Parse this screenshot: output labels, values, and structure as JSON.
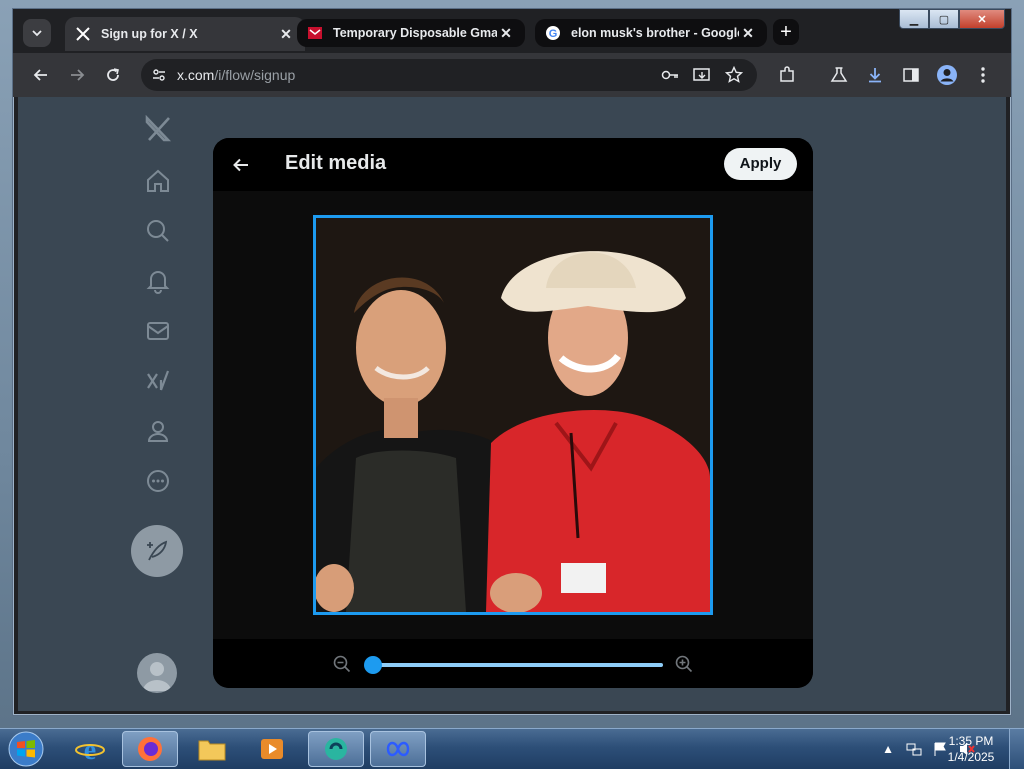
{
  "browser": {
    "tabs": [
      {
        "title": "Sign up for X / X",
        "active": true,
        "icon": "x-logo-icon"
      },
      {
        "title": "Temporary Disposable Gmail |",
        "active": false,
        "icon": "temp-mail-icon"
      },
      {
        "title": "elon musk's brother - Google S",
        "active": false,
        "icon": "google-icon"
      }
    ],
    "address": {
      "host": "x.com",
      "path": "/i/flow/signup"
    }
  },
  "sidebar": {
    "items": [
      "x-logo-icon",
      "home-icon",
      "search-icon",
      "notifications-icon",
      "messages-icon",
      "grok-icon",
      "profile-icon",
      "more-icon"
    ],
    "compose_icon": "compose-post-icon"
  },
  "modal": {
    "title": "Edit media",
    "apply_label": "Apply",
    "zoom": {
      "level": 0.0
    }
  },
  "taskbar": {
    "apps": [
      "internet-explorer-icon",
      "firefox-icon",
      "file-explorer-icon",
      "media-player-icon",
      "ai-assistant-icon",
      "chrome-window-icon"
    ],
    "clock_time": "1:35 PM",
    "clock_date": "1/4/2025"
  },
  "colors": {
    "accent": "#1d9bf0",
    "modal_bg": "#000000",
    "page_overlay": "#3a4753"
  }
}
